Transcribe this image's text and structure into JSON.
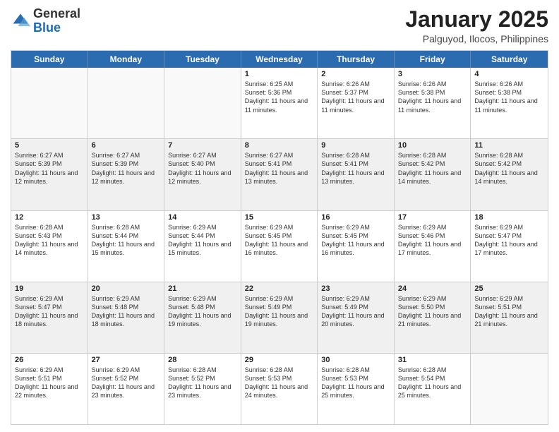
{
  "logo": {
    "general": "General",
    "blue": "Blue"
  },
  "title": "January 2025",
  "location": "Palguyod, Ilocos, Philippines",
  "days": [
    "Sunday",
    "Monday",
    "Tuesday",
    "Wednesday",
    "Thursday",
    "Friday",
    "Saturday"
  ],
  "weeks": [
    [
      {
        "day": "",
        "sunrise": "",
        "sunset": "",
        "daylight": "",
        "empty": true
      },
      {
        "day": "",
        "sunrise": "",
        "sunset": "",
        "daylight": "",
        "empty": true
      },
      {
        "day": "",
        "sunrise": "",
        "sunset": "",
        "daylight": "",
        "empty": true
      },
      {
        "day": "1",
        "sunrise": "Sunrise: 6:25 AM",
        "sunset": "Sunset: 5:36 PM",
        "daylight": "Daylight: 11 hours and 11 minutes."
      },
      {
        "day": "2",
        "sunrise": "Sunrise: 6:26 AM",
        "sunset": "Sunset: 5:37 PM",
        "daylight": "Daylight: 11 hours and 11 minutes."
      },
      {
        "day": "3",
        "sunrise": "Sunrise: 6:26 AM",
        "sunset": "Sunset: 5:38 PM",
        "daylight": "Daylight: 11 hours and 11 minutes."
      },
      {
        "day": "4",
        "sunrise": "Sunrise: 6:26 AM",
        "sunset": "Sunset: 5:38 PM",
        "daylight": "Daylight: 11 hours and 11 minutes."
      }
    ],
    [
      {
        "day": "5",
        "sunrise": "Sunrise: 6:27 AM",
        "sunset": "Sunset: 5:39 PM",
        "daylight": "Daylight: 11 hours and 12 minutes."
      },
      {
        "day": "6",
        "sunrise": "Sunrise: 6:27 AM",
        "sunset": "Sunset: 5:39 PM",
        "daylight": "Daylight: 11 hours and 12 minutes."
      },
      {
        "day": "7",
        "sunrise": "Sunrise: 6:27 AM",
        "sunset": "Sunset: 5:40 PM",
        "daylight": "Daylight: 11 hours and 12 minutes."
      },
      {
        "day": "8",
        "sunrise": "Sunrise: 6:27 AM",
        "sunset": "Sunset: 5:41 PM",
        "daylight": "Daylight: 11 hours and 13 minutes."
      },
      {
        "day": "9",
        "sunrise": "Sunrise: 6:28 AM",
        "sunset": "Sunset: 5:41 PM",
        "daylight": "Daylight: 11 hours and 13 minutes."
      },
      {
        "day": "10",
        "sunrise": "Sunrise: 6:28 AM",
        "sunset": "Sunset: 5:42 PM",
        "daylight": "Daylight: 11 hours and 14 minutes."
      },
      {
        "day": "11",
        "sunrise": "Sunrise: 6:28 AM",
        "sunset": "Sunset: 5:42 PM",
        "daylight": "Daylight: 11 hours and 14 minutes."
      }
    ],
    [
      {
        "day": "12",
        "sunrise": "Sunrise: 6:28 AM",
        "sunset": "Sunset: 5:43 PM",
        "daylight": "Daylight: 11 hours and 14 minutes."
      },
      {
        "day": "13",
        "sunrise": "Sunrise: 6:28 AM",
        "sunset": "Sunset: 5:44 PM",
        "daylight": "Daylight: 11 hours and 15 minutes."
      },
      {
        "day": "14",
        "sunrise": "Sunrise: 6:29 AM",
        "sunset": "Sunset: 5:44 PM",
        "daylight": "Daylight: 11 hours and 15 minutes."
      },
      {
        "day": "15",
        "sunrise": "Sunrise: 6:29 AM",
        "sunset": "Sunset: 5:45 PM",
        "daylight": "Daylight: 11 hours and 16 minutes."
      },
      {
        "day": "16",
        "sunrise": "Sunrise: 6:29 AM",
        "sunset": "Sunset: 5:45 PM",
        "daylight": "Daylight: 11 hours and 16 minutes."
      },
      {
        "day": "17",
        "sunrise": "Sunrise: 6:29 AM",
        "sunset": "Sunset: 5:46 PM",
        "daylight": "Daylight: 11 hours and 17 minutes."
      },
      {
        "day": "18",
        "sunrise": "Sunrise: 6:29 AM",
        "sunset": "Sunset: 5:47 PM",
        "daylight": "Daylight: 11 hours and 17 minutes."
      }
    ],
    [
      {
        "day": "19",
        "sunrise": "Sunrise: 6:29 AM",
        "sunset": "Sunset: 5:47 PM",
        "daylight": "Daylight: 11 hours and 18 minutes."
      },
      {
        "day": "20",
        "sunrise": "Sunrise: 6:29 AM",
        "sunset": "Sunset: 5:48 PM",
        "daylight": "Daylight: 11 hours and 18 minutes."
      },
      {
        "day": "21",
        "sunrise": "Sunrise: 6:29 AM",
        "sunset": "Sunset: 5:48 PM",
        "daylight": "Daylight: 11 hours and 19 minutes."
      },
      {
        "day": "22",
        "sunrise": "Sunrise: 6:29 AM",
        "sunset": "Sunset: 5:49 PM",
        "daylight": "Daylight: 11 hours and 19 minutes."
      },
      {
        "day": "23",
        "sunrise": "Sunrise: 6:29 AM",
        "sunset": "Sunset: 5:49 PM",
        "daylight": "Daylight: 11 hours and 20 minutes."
      },
      {
        "day": "24",
        "sunrise": "Sunrise: 6:29 AM",
        "sunset": "Sunset: 5:50 PM",
        "daylight": "Daylight: 11 hours and 21 minutes."
      },
      {
        "day": "25",
        "sunrise": "Sunrise: 6:29 AM",
        "sunset": "Sunset: 5:51 PM",
        "daylight": "Daylight: 11 hours and 21 minutes."
      }
    ],
    [
      {
        "day": "26",
        "sunrise": "Sunrise: 6:29 AM",
        "sunset": "Sunset: 5:51 PM",
        "daylight": "Daylight: 11 hours and 22 minutes."
      },
      {
        "day": "27",
        "sunrise": "Sunrise: 6:29 AM",
        "sunset": "Sunset: 5:52 PM",
        "daylight": "Daylight: 11 hours and 23 minutes."
      },
      {
        "day": "28",
        "sunrise": "Sunrise: 6:28 AM",
        "sunset": "Sunset: 5:52 PM",
        "daylight": "Daylight: 11 hours and 23 minutes."
      },
      {
        "day": "29",
        "sunrise": "Sunrise: 6:28 AM",
        "sunset": "Sunset: 5:53 PM",
        "daylight": "Daylight: 11 hours and 24 minutes."
      },
      {
        "day": "30",
        "sunrise": "Sunrise: 6:28 AM",
        "sunset": "Sunset: 5:53 PM",
        "daylight": "Daylight: 11 hours and 25 minutes."
      },
      {
        "day": "31",
        "sunrise": "Sunrise: 6:28 AM",
        "sunset": "Sunset: 5:54 PM",
        "daylight": "Daylight: 11 hours and 25 minutes."
      },
      {
        "day": "",
        "sunrise": "",
        "sunset": "",
        "daylight": "",
        "empty": true
      }
    ]
  ]
}
